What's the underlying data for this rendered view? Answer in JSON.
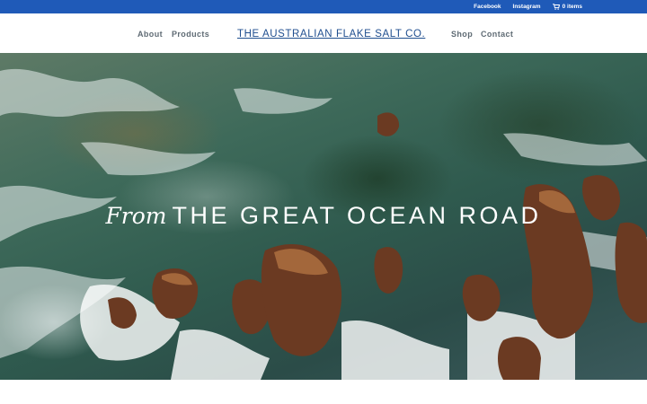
{
  "topbar": {
    "facebook": "Facebook",
    "instagram": "Instagram",
    "cart": "0 items",
    "cart_icon": "cart-icon",
    "color": "#1f5ab8"
  },
  "nav": {
    "about": "About",
    "products": "Products",
    "shop": "Shop",
    "contact": "Contact"
  },
  "logo": "THE AUSTRALIAN FLAKE SALT CO.",
  "hero": {
    "script": "From",
    "title": "THE GREAT OCEAN ROAD"
  }
}
